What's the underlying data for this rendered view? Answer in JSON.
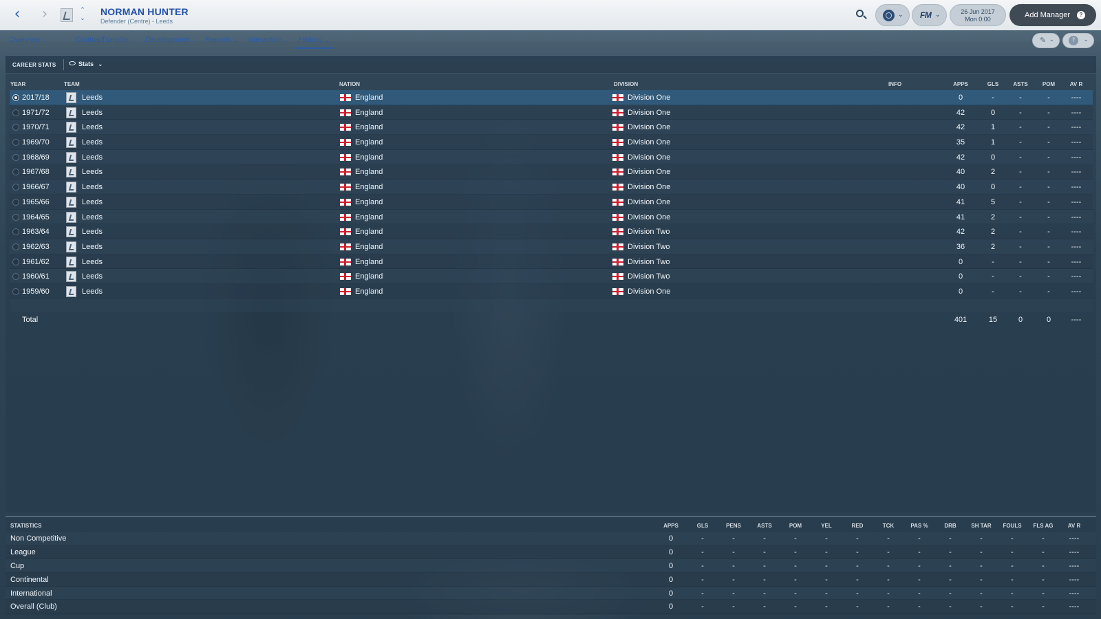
{
  "header": {
    "player_name": "NORMAN HUNTER",
    "player_sub": "Defender (Centre) - Leeds",
    "back_icon": "chevron-left-icon",
    "forward_icon": "chevron-right-icon",
    "date_line1": "26 Jun 2017",
    "date_line2": "Mon 0:00",
    "add_manager_label": "Add Manager",
    "fm_label": "FM"
  },
  "tabs": [
    {
      "label": "Overview"
    },
    {
      "label": "Contract"
    },
    {
      "label": "Transfer"
    },
    {
      "label": "Development"
    },
    {
      "label": "Reports"
    },
    {
      "label": "Interaction"
    },
    {
      "label": "History"
    }
  ],
  "active_tab": "History",
  "career": {
    "title": "CAREER STATS",
    "view_label": "Stats",
    "columns": {
      "year": "YEAR",
      "team": "TEAM",
      "nation": "NATION",
      "division": "DIVISION",
      "info": "INFO",
      "apps": "APPS",
      "gls": "GLS",
      "asts": "ASTS",
      "pom": "POM",
      "avr": "AV R"
    },
    "rows": [
      {
        "year": "2017/18",
        "team": "Leeds",
        "nation": "England",
        "division": "Division One",
        "apps": "0",
        "gls": "-",
        "asts": "-",
        "pom": "-",
        "avr": "----",
        "selected": true
      },
      {
        "year": "1971/72",
        "team": "Leeds",
        "nation": "England",
        "division": "Division One",
        "apps": "42",
        "gls": "0",
        "asts": "-",
        "pom": "-",
        "avr": "----"
      },
      {
        "year": "1970/71",
        "team": "Leeds",
        "nation": "England",
        "division": "Division One",
        "apps": "42",
        "gls": "1",
        "asts": "-",
        "pom": "-",
        "avr": "----"
      },
      {
        "year": "1969/70",
        "team": "Leeds",
        "nation": "England",
        "division": "Division One",
        "apps": "35",
        "gls": "1",
        "asts": "-",
        "pom": "-",
        "avr": "----"
      },
      {
        "year": "1968/69",
        "team": "Leeds",
        "nation": "England",
        "division": "Division One",
        "apps": "42",
        "gls": "0",
        "asts": "-",
        "pom": "-",
        "avr": "----"
      },
      {
        "year": "1967/68",
        "team": "Leeds",
        "nation": "England",
        "division": "Division One",
        "apps": "40",
        "gls": "2",
        "asts": "-",
        "pom": "-",
        "avr": "----"
      },
      {
        "year": "1966/67",
        "team": "Leeds",
        "nation": "England",
        "division": "Division One",
        "apps": "40",
        "gls": "0",
        "asts": "-",
        "pom": "-",
        "avr": "----"
      },
      {
        "year": "1965/66",
        "team": "Leeds",
        "nation": "England",
        "division": "Division One",
        "apps": "41",
        "gls": "5",
        "asts": "-",
        "pom": "-",
        "avr": "----"
      },
      {
        "year": "1964/65",
        "team": "Leeds",
        "nation": "England",
        "division": "Division One",
        "apps": "41",
        "gls": "2",
        "asts": "-",
        "pom": "-",
        "avr": "----"
      },
      {
        "year": "1963/64",
        "team": "Leeds",
        "nation": "England",
        "division": "Division Two",
        "apps": "42",
        "gls": "2",
        "asts": "-",
        "pom": "-",
        "avr": "----"
      },
      {
        "year": "1962/63",
        "team": "Leeds",
        "nation": "England",
        "division": "Division Two",
        "apps": "36",
        "gls": "2",
        "asts": "-",
        "pom": "-",
        "avr": "----"
      },
      {
        "year": "1961/62",
        "team": "Leeds",
        "nation": "England",
        "division": "Division Two",
        "apps": "0",
        "gls": "-",
        "asts": "-",
        "pom": "-",
        "avr": "----"
      },
      {
        "year": "1960/61",
        "team": "Leeds",
        "nation": "England",
        "division": "Division Two",
        "apps": "0",
        "gls": "-",
        "asts": "-",
        "pom": "-",
        "avr": "----"
      },
      {
        "year": "1959/60",
        "team": "Leeds",
        "nation": "England",
        "division": "Division One",
        "apps": "0",
        "gls": "-",
        "asts": "-",
        "pom": "-",
        "avr": "----"
      }
    ],
    "total": {
      "label": "Total",
      "apps": "401",
      "gls": "15",
      "asts": "0",
      "pom": "0",
      "avr": "----"
    }
  },
  "statistics": {
    "title": "STATISTICS",
    "columns": [
      "APPS",
      "GLS",
      "PENS",
      "ASTS",
      "POM",
      "YEL",
      "RED",
      "TCK",
      "PAS %",
      "DRB",
      "SH TAR",
      "FOULS",
      "FLS AG",
      "AV R"
    ],
    "rows": [
      {
        "label": "Non Competitive",
        "values": [
          "0",
          "-",
          "-",
          "-",
          "-",
          "-",
          "-",
          "-",
          "-",
          "-",
          "-",
          "-",
          "-",
          "----"
        ]
      },
      {
        "label": "League",
        "values": [
          "0",
          "-",
          "-",
          "-",
          "-",
          "-",
          "-",
          "-",
          "-",
          "-",
          "-",
          "-",
          "-",
          "----"
        ]
      },
      {
        "label": "Cup",
        "values": [
          "0",
          "-",
          "-",
          "-",
          "-",
          "-",
          "-",
          "-",
          "-",
          "-",
          "-",
          "-",
          "-",
          "----"
        ]
      },
      {
        "label": "Continental",
        "values": [
          "0",
          "-",
          "-",
          "-",
          "-",
          "-",
          "-",
          "-",
          "-",
          "-",
          "-",
          "-",
          "-",
          "----"
        ]
      },
      {
        "label": "International",
        "values": [
          "0",
          "-",
          "-",
          "-",
          "-",
          "-",
          "-",
          "-",
          "-",
          "-",
          "-",
          "-",
          "-",
          "----"
        ]
      },
      {
        "label": "Overall (Club)",
        "values": [
          "0",
          "-",
          "-",
          "-",
          "-",
          "-",
          "-",
          "-",
          "-",
          "-",
          "-",
          "-",
          "-",
          "----"
        ]
      }
    ]
  },
  "colors": {
    "accent_blue": "#2c5aa3",
    "selected_row": "#315979",
    "england_red": "#cf1f2e"
  }
}
